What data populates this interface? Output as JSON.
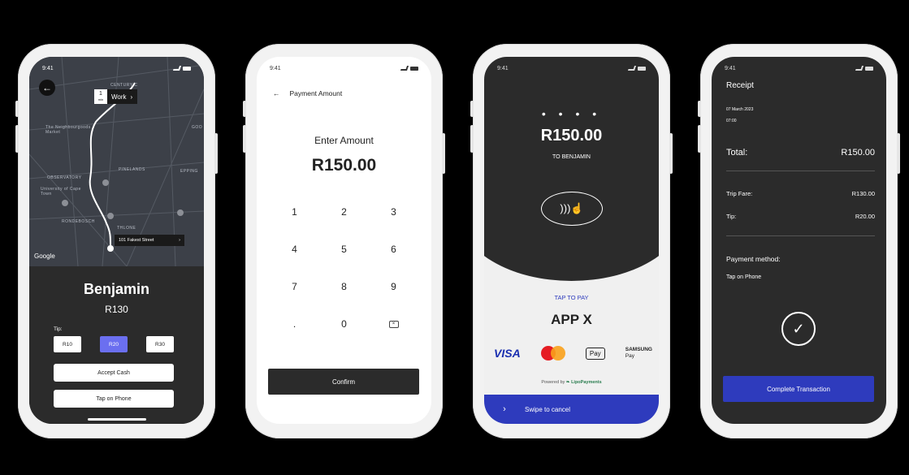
{
  "status_time": "9:41",
  "ride": {
    "back_icon": "arrow-left-icon",
    "work_badge": "1",
    "work_badge_sub": "min",
    "work_label": "Work",
    "street_label": "101 Fakest Street",
    "map_labels": [
      "CENTURY C",
      "The Neighbourgoods Market",
      "OBSERVATORY",
      "University of Cape Town",
      "PINELANDS",
      "RONDEBOSCH",
      "THLONE",
      "EPPING",
      "GOO"
    ],
    "google": "Google",
    "driver_name": "Benjamin",
    "fare": "R130",
    "tip_label": "Tip:",
    "tip_options": [
      "R10",
      "R20",
      "R30"
    ],
    "tip_selected": "R20",
    "accept_cash": "Accept Cash",
    "tap_on_phone": "Tap on Phone"
  },
  "payment": {
    "header": "Payment Amount",
    "enter_label": "Enter Amount",
    "amount": "R150.00",
    "keys": [
      "1",
      "2",
      "3",
      "4",
      "5",
      "6",
      "7",
      "8",
      "9",
      ".",
      "0"
    ],
    "confirm": "Confirm"
  },
  "tap": {
    "dots": "• • • •",
    "amount": "R150.00",
    "to_label": "TO BENJAMIN",
    "tap_to_pay": "TAP TO PAY",
    "app_name": "APP X",
    "visa": "VISA",
    "apple_pay": "Pay",
    "samsung": "SAMSUNG",
    "samsung_sub": "Pay",
    "powered_by": "Powered by",
    "powered_brand": "LipoPayments",
    "swipe": "Swipe to cancel"
  },
  "receipt": {
    "title": "Receipt",
    "date": "07 March 2023",
    "time": "07:00",
    "total_label": "Total:",
    "total_value": "R150.00",
    "fare_label": "Trip Fare:",
    "fare_value": "R130.00",
    "tip_label": "Tip:",
    "tip_value": "R20.00",
    "pm_label": "Payment method:",
    "pm_value": "Tap on Phone",
    "complete": "Complete Transaction"
  },
  "colors": {
    "accent_blue": "#2e3bbd",
    "tip_selected": "#6b6ff0",
    "dark_panel": "#2b2b2b"
  }
}
